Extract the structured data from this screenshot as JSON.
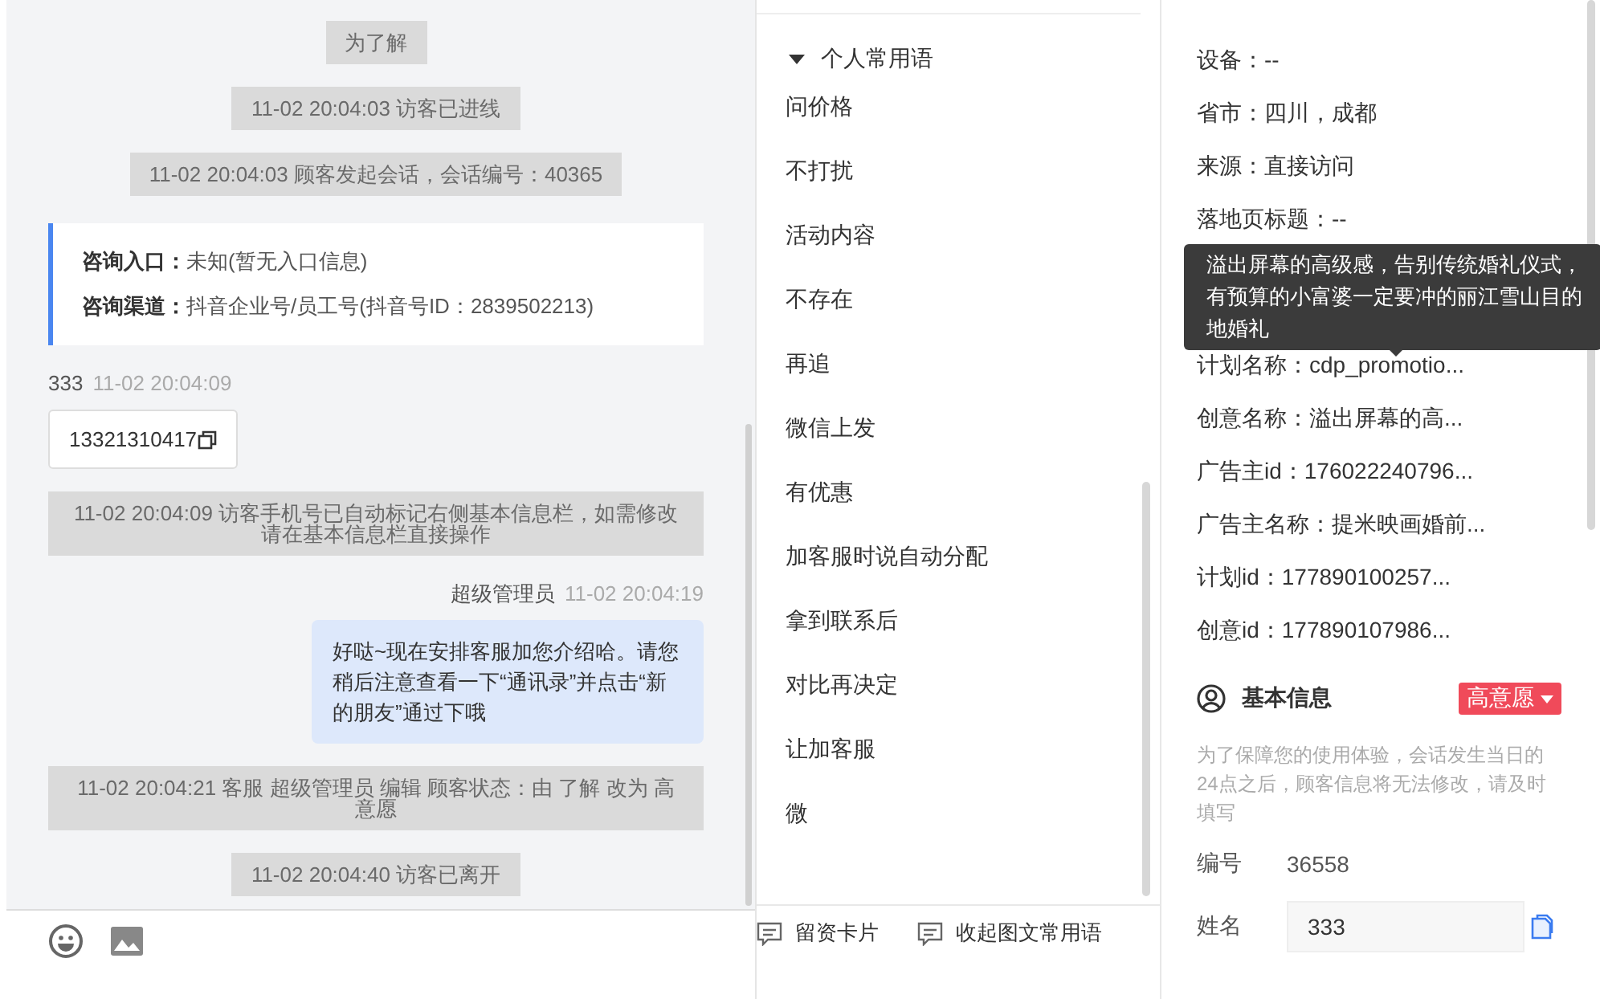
{
  "chat": {
    "messages": [
      {
        "kind": "system",
        "text": "为了解"
      },
      {
        "kind": "system",
        "text": "11-02 20:04:03 访客已进线"
      },
      {
        "kind": "system",
        "text": "11-02 20:04:03 顾客发起会话，会话编号：40365"
      },
      {
        "kind": "info",
        "lines": [
          {
            "label": "咨询入口：",
            "value": "未知(暂无入口信息)"
          },
          {
            "label": "咨询渠道：",
            "value": "抖音企业号/员工号(抖音号ID：2839502213)"
          }
        ]
      },
      {
        "kind": "visitor",
        "name": "333",
        "time": "11-02 20:04:09",
        "text": "13321310417"
      },
      {
        "kind": "system",
        "text": "11-02 20:04:09 访客手机号已自动标记右侧基本信息栏，如需修改请在基本信息栏直接操作"
      },
      {
        "kind": "agent",
        "name": "超级管理员",
        "time": "11-02 20:04:19",
        "text": "好哒~现在安排客服加您介绍哈。请您稍后注意查看一下“通讯录”并点击“新的朋友”通过下哦"
      },
      {
        "kind": "system",
        "text": "11-02 20:04:21 客服 超级管理员 编辑 顾客状态：由 了解 改为 高意愿"
      },
      {
        "kind": "system",
        "text": "11-02 20:04:40 访客已离开"
      }
    ]
  },
  "phrases": {
    "group": {
      "label": "个人常用语",
      "expanded": true
    },
    "items": [
      "问价格",
      "不打扰",
      "活动内容",
      "不存在",
      "再追",
      "微信上发",
      "有优惠",
      "加客服时说自动分配",
      "拿到联系后",
      "对比再决定",
      "让加客服",
      "微"
    ],
    "actions": [
      "留资卡片",
      "收起图文常用语"
    ]
  },
  "source": {
    "fields": [
      "设备：--",
      "省市：四川，成都",
      "来源：直接访问",
      "落地页标题：--",
      "计划名称：cdp_promotio...",
      "创意名称：溢出屏幕的高...",
      "广告主id：176022240796...",
      "广告主名称：提米映画婚前...",
      "计划id：177890100257...",
      "创意id：177890107986..."
    ],
    "tooltip": "溢出屏幕的高级感，告别传统婚礼仪式，有预算的小富婆一定要冲的丽江雪山目的地婚礼"
  },
  "basic": {
    "title": "基本信息",
    "status": "高意愿",
    "note": "为了保障您的使用体验，会话发生当日的24点之后，顾客信息将无法修改，请及时填写",
    "fields": [
      {
        "kind": "text",
        "label": "编号",
        "value": "36558"
      },
      {
        "kind": "input",
        "label": "姓名",
        "value": "333"
      }
    ]
  }
}
